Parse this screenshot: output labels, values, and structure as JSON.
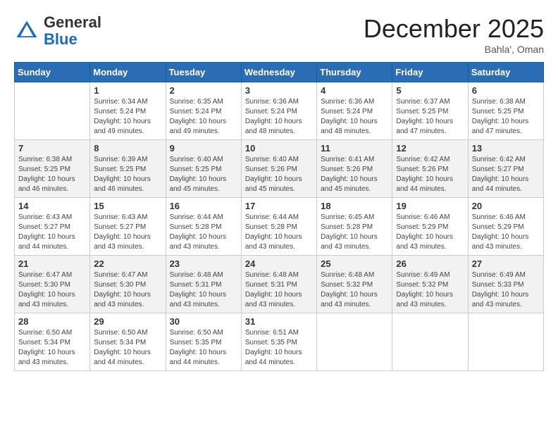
{
  "header": {
    "logo_general": "General",
    "logo_blue": "Blue",
    "month_title": "December 2025",
    "location": "Bahla', Oman"
  },
  "days_of_week": [
    "Sunday",
    "Monday",
    "Tuesday",
    "Wednesday",
    "Thursday",
    "Friday",
    "Saturday"
  ],
  "weeks": [
    [
      {
        "day": "",
        "info": ""
      },
      {
        "day": "1",
        "info": "Sunrise: 6:34 AM\nSunset: 5:24 PM\nDaylight: 10 hours\nand 49 minutes."
      },
      {
        "day": "2",
        "info": "Sunrise: 6:35 AM\nSunset: 5:24 PM\nDaylight: 10 hours\nand 49 minutes."
      },
      {
        "day": "3",
        "info": "Sunrise: 6:36 AM\nSunset: 5:24 PM\nDaylight: 10 hours\nand 48 minutes."
      },
      {
        "day": "4",
        "info": "Sunrise: 6:36 AM\nSunset: 5:24 PM\nDaylight: 10 hours\nand 48 minutes."
      },
      {
        "day": "5",
        "info": "Sunrise: 6:37 AM\nSunset: 5:25 PM\nDaylight: 10 hours\nand 47 minutes."
      },
      {
        "day": "6",
        "info": "Sunrise: 6:38 AM\nSunset: 5:25 PM\nDaylight: 10 hours\nand 47 minutes."
      }
    ],
    [
      {
        "day": "7",
        "info": "Sunrise: 6:38 AM\nSunset: 5:25 PM\nDaylight: 10 hours\nand 46 minutes."
      },
      {
        "day": "8",
        "info": "Sunrise: 6:39 AM\nSunset: 5:25 PM\nDaylight: 10 hours\nand 46 minutes."
      },
      {
        "day": "9",
        "info": "Sunrise: 6:40 AM\nSunset: 5:25 PM\nDaylight: 10 hours\nand 45 minutes."
      },
      {
        "day": "10",
        "info": "Sunrise: 6:40 AM\nSunset: 5:26 PM\nDaylight: 10 hours\nand 45 minutes."
      },
      {
        "day": "11",
        "info": "Sunrise: 6:41 AM\nSunset: 5:26 PM\nDaylight: 10 hours\nand 45 minutes."
      },
      {
        "day": "12",
        "info": "Sunrise: 6:42 AM\nSunset: 5:26 PM\nDaylight: 10 hours\nand 44 minutes."
      },
      {
        "day": "13",
        "info": "Sunrise: 6:42 AM\nSunset: 5:27 PM\nDaylight: 10 hours\nand 44 minutes."
      }
    ],
    [
      {
        "day": "14",
        "info": "Sunrise: 6:43 AM\nSunset: 5:27 PM\nDaylight: 10 hours\nand 44 minutes."
      },
      {
        "day": "15",
        "info": "Sunrise: 6:43 AM\nSunset: 5:27 PM\nDaylight: 10 hours\nand 43 minutes."
      },
      {
        "day": "16",
        "info": "Sunrise: 6:44 AM\nSunset: 5:28 PM\nDaylight: 10 hours\nand 43 minutes."
      },
      {
        "day": "17",
        "info": "Sunrise: 6:44 AM\nSunset: 5:28 PM\nDaylight: 10 hours\nand 43 minutes."
      },
      {
        "day": "18",
        "info": "Sunrise: 6:45 AM\nSunset: 5:28 PM\nDaylight: 10 hours\nand 43 minutes."
      },
      {
        "day": "19",
        "info": "Sunrise: 6:46 AM\nSunset: 5:29 PM\nDaylight: 10 hours\nand 43 minutes."
      },
      {
        "day": "20",
        "info": "Sunrise: 6:46 AM\nSunset: 5:29 PM\nDaylight: 10 hours\nand 43 minutes."
      }
    ],
    [
      {
        "day": "21",
        "info": "Sunrise: 6:47 AM\nSunset: 5:30 PM\nDaylight: 10 hours\nand 43 minutes."
      },
      {
        "day": "22",
        "info": "Sunrise: 6:47 AM\nSunset: 5:30 PM\nDaylight: 10 hours\nand 43 minutes."
      },
      {
        "day": "23",
        "info": "Sunrise: 6:48 AM\nSunset: 5:31 PM\nDaylight: 10 hours\nand 43 minutes."
      },
      {
        "day": "24",
        "info": "Sunrise: 6:48 AM\nSunset: 5:31 PM\nDaylight: 10 hours\nand 43 minutes."
      },
      {
        "day": "25",
        "info": "Sunrise: 6:48 AM\nSunset: 5:32 PM\nDaylight: 10 hours\nand 43 minutes."
      },
      {
        "day": "26",
        "info": "Sunrise: 6:49 AM\nSunset: 5:32 PM\nDaylight: 10 hours\nand 43 minutes."
      },
      {
        "day": "27",
        "info": "Sunrise: 6:49 AM\nSunset: 5:33 PM\nDaylight: 10 hours\nand 43 minutes."
      }
    ],
    [
      {
        "day": "28",
        "info": "Sunrise: 6:50 AM\nSunset: 5:34 PM\nDaylight: 10 hours\nand 43 minutes."
      },
      {
        "day": "29",
        "info": "Sunrise: 6:50 AM\nSunset: 5:34 PM\nDaylight: 10 hours\nand 44 minutes."
      },
      {
        "day": "30",
        "info": "Sunrise: 6:50 AM\nSunset: 5:35 PM\nDaylight: 10 hours\nand 44 minutes."
      },
      {
        "day": "31",
        "info": "Sunrise: 6:51 AM\nSunset: 5:35 PM\nDaylight: 10 hours\nand 44 minutes."
      },
      {
        "day": "",
        "info": ""
      },
      {
        "day": "",
        "info": ""
      },
      {
        "day": "",
        "info": ""
      }
    ]
  ]
}
